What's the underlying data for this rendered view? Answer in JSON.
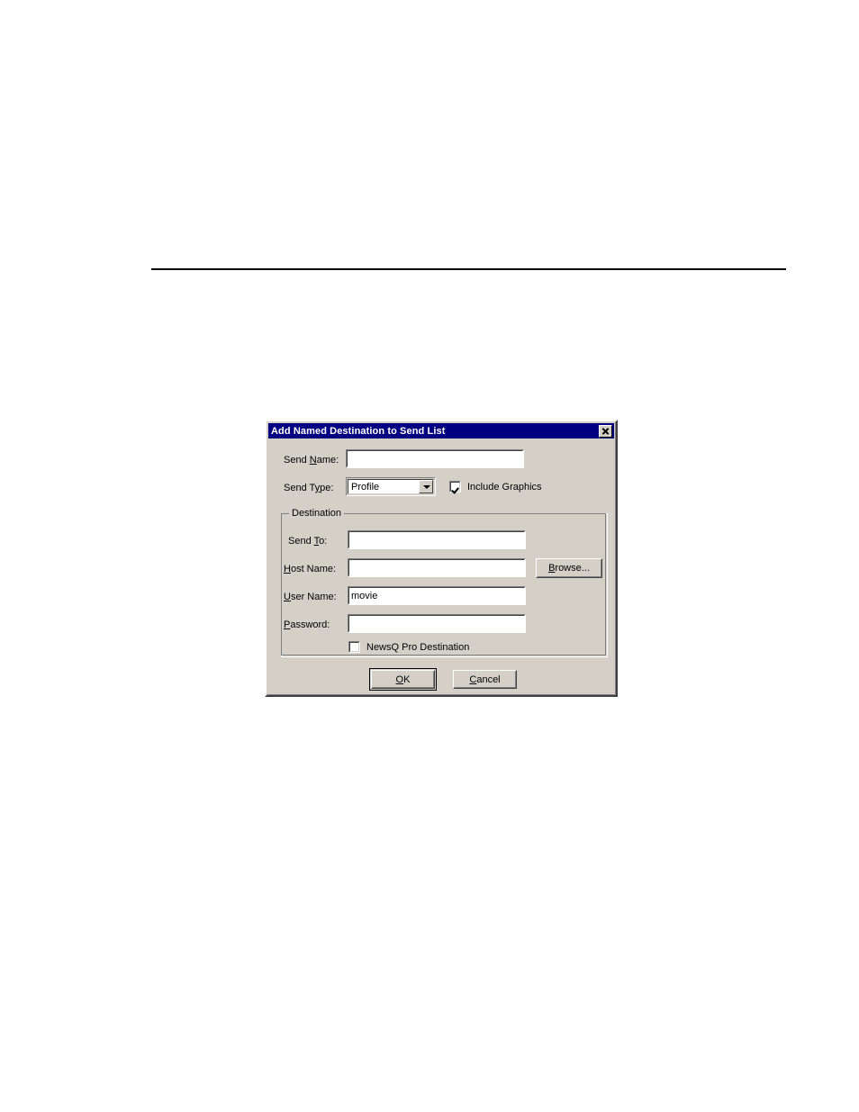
{
  "page": {
    "rule": "horizontal-rule"
  },
  "dialog": {
    "title": "Add Named Destination to Send List",
    "close_icon": "close-icon",
    "fields": {
      "send_name_label": "Send Name:",
      "send_name_label_pre": "Send ",
      "send_name_label_accel": "N",
      "send_name_label_post": "ame:",
      "send_name_value": "",
      "send_type_label_pre": "Send T",
      "send_type_label_accel": "y",
      "send_type_label_post": "pe:",
      "send_type_value": "Profile",
      "send_type_options": [
        "Profile"
      ],
      "include_graphics_label": "Include Graphics",
      "include_graphics_checked": true
    },
    "destination": {
      "legend": "Destination",
      "send_to_label_pre": "Send ",
      "send_to_label_accel": "T",
      "send_to_label_post": "o:",
      "send_to_value": "",
      "host_name_label_pre": "",
      "host_name_label_accel": "H",
      "host_name_label_post": "ost Name:",
      "host_name_value": "",
      "browse_label_pre": "",
      "browse_label_accel": "B",
      "browse_label_post": "rowse...",
      "user_name_label_pre": "",
      "user_name_label_accel": "U",
      "user_name_label_post": "ser Name:",
      "user_name_value": "movie",
      "password_label_pre": "",
      "password_label_accel": "P",
      "password_label_post": "assword:",
      "password_value": "",
      "newsq_label": "NewsQ Pro Destination",
      "newsq_checked": false
    },
    "buttons": {
      "ok_pre": "",
      "ok_accel": "O",
      "ok_post": "K",
      "cancel_pre": "",
      "cancel_accel": "C",
      "cancel_post": "ancel"
    },
    "colors": {
      "titlebar": "#000080",
      "face": "#d4d0c8",
      "field": "#ffffff",
      "shadow": "#808080",
      "dark": "#404040"
    }
  }
}
